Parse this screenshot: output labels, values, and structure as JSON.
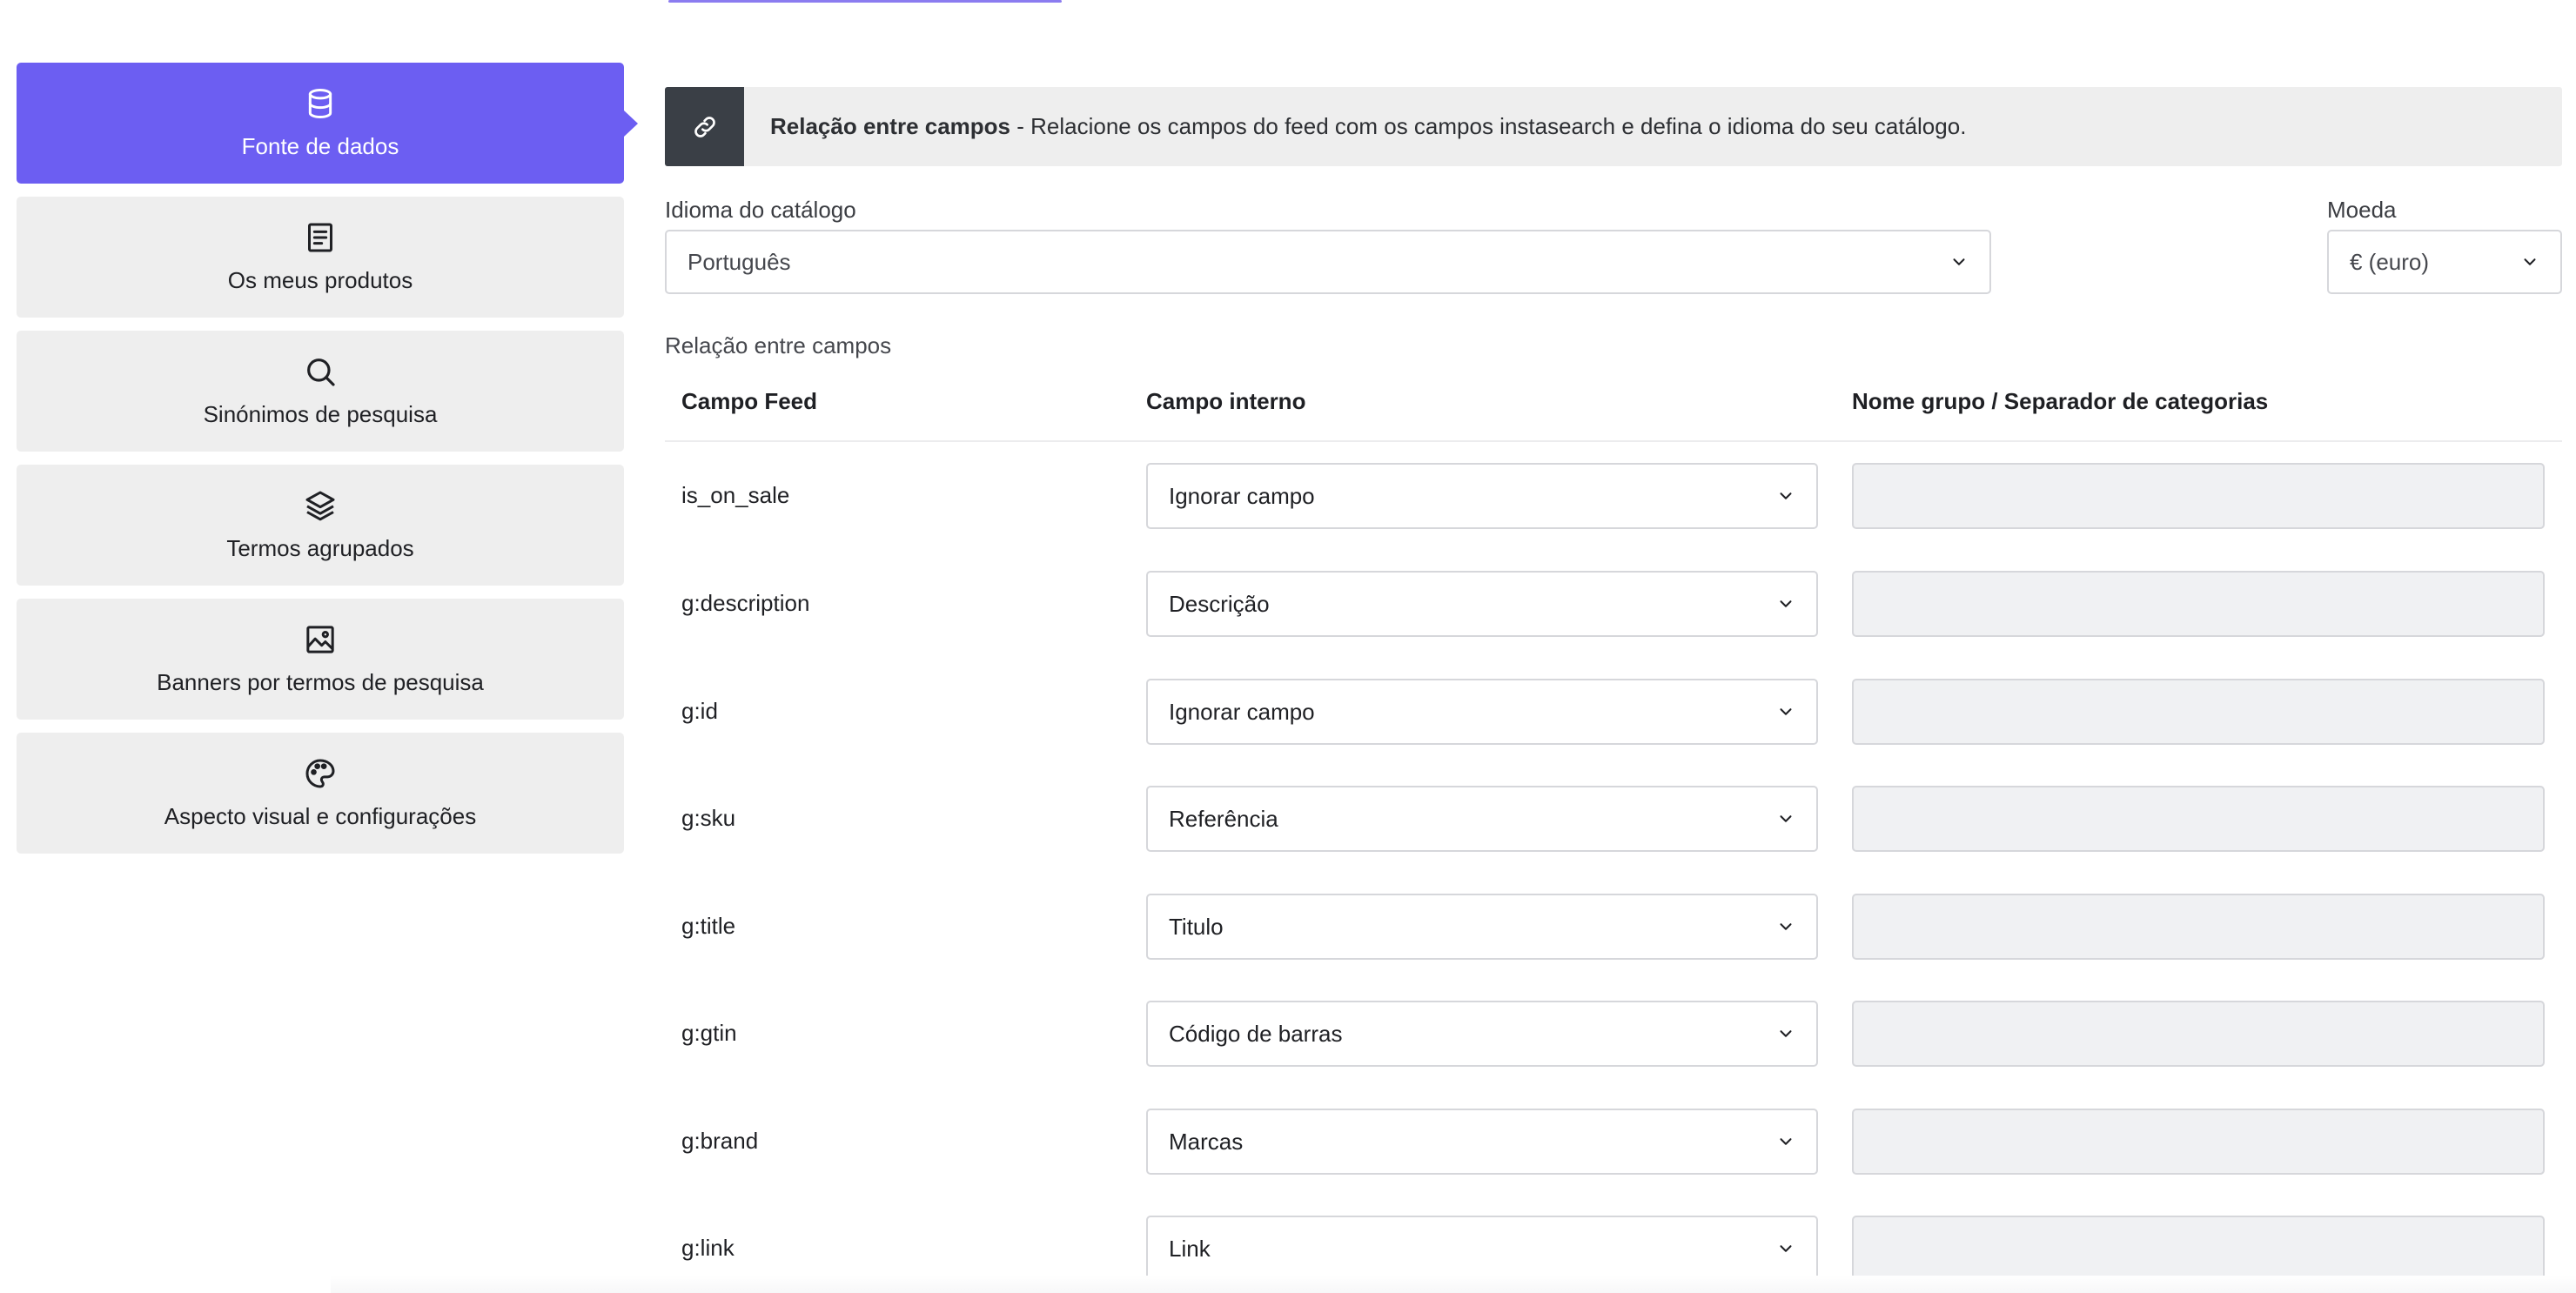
{
  "sidebar": {
    "items": [
      {
        "label": "Fonte de dados",
        "icon": "database-icon",
        "active": true
      },
      {
        "label": "Os meus produtos",
        "icon": "document-list-icon",
        "active": false
      },
      {
        "label": "Sinónimos de pesquisa",
        "icon": "search-icon",
        "active": false
      },
      {
        "label": "Termos agrupados",
        "icon": "layers-icon",
        "active": false
      },
      {
        "label": "Banners por termos de pesquisa",
        "icon": "image-icon",
        "active": false
      },
      {
        "label": "Aspecto visual e configurações",
        "icon": "palette-icon",
        "active": false
      }
    ]
  },
  "info_bar": {
    "icon": "link-icon",
    "title": "Relação entre campos",
    "text": " - Relacione os campos do feed com os campos instasearch e defina o idioma do seu catálogo."
  },
  "catalog_language": {
    "label": "Idioma do catálogo",
    "value": "Português"
  },
  "currency": {
    "label": "Moeda",
    "value": "€ (euro)"
  },
  "mapping": {
    "section_label": "Relação entre campos",
    "headers": {
      "feed": "Campo Feed",
      "internal": "Campo interno",
      "group": "Nome grupo / Separador de categorias"
    },
    "rows": [
      {
        "feed": "is_on_sale",
        "internal": "Ignorar campo",
        "group": ""
      },
      {
        "feed": "g:description",
        "internal": "Descrição",
        "group": ""
      },
      {
        "feed": "g:id",
        "internal": "Ignorar campo",
        "group": ""
      },
      {
        "feed": "g:sku",
        "internal": "Referência",
        "group": ""
      },
      {
        "feed": "g:title",
        "internal": "Titulo",
        "group": ""
      },
      {
        "feed": "g:gtin",
        "internal": "Código de barras",
        "group": ""
      },
      {
        "feed": "g:brand",
        "internal": "Marcas",
        "group": ""
      },
      {
        "feed": "g:link",
        "internal": "Link",
        "group": ""
      }
    ]
  },
  "colors": {
    "accent": "#6c5ef2",
    "info_icon_bg": "#3a3f46"
  }
}
